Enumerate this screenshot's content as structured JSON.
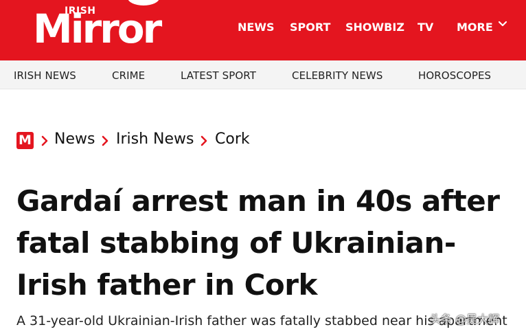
{
  "header": {
    "logo_small": "IRISH",
    "logo_big": "Mirror",
    "brand_color": "#e4151f",
    "nav": [
      "NEWS",
      "SPORT",
      "SHOWBIZ",
      "TV",
      "MORE"
    ]
  },
  "subnav": [
    "IRISH NEWS",
    "CRIME",
    "LATEST SPORT",
    "CELEBRITY NEWS",
    "HOROSCOPES"
  ],
  "breadcrumb": {
    "badge": "M",
    "items": [
      "News",
      "Irish News",
      "Cork"
    ]
  },
  "article": {
    "headline": "Gardaí arrest man in 40s after fatal stabbing of Ukrainian-Irish father in Cork",
    "standfirst": "A 31-year-old Ukrainian-Irish father was fatally stabbed near his apartment"
  },
  "watermark": "头条 @吴大辉"
}
